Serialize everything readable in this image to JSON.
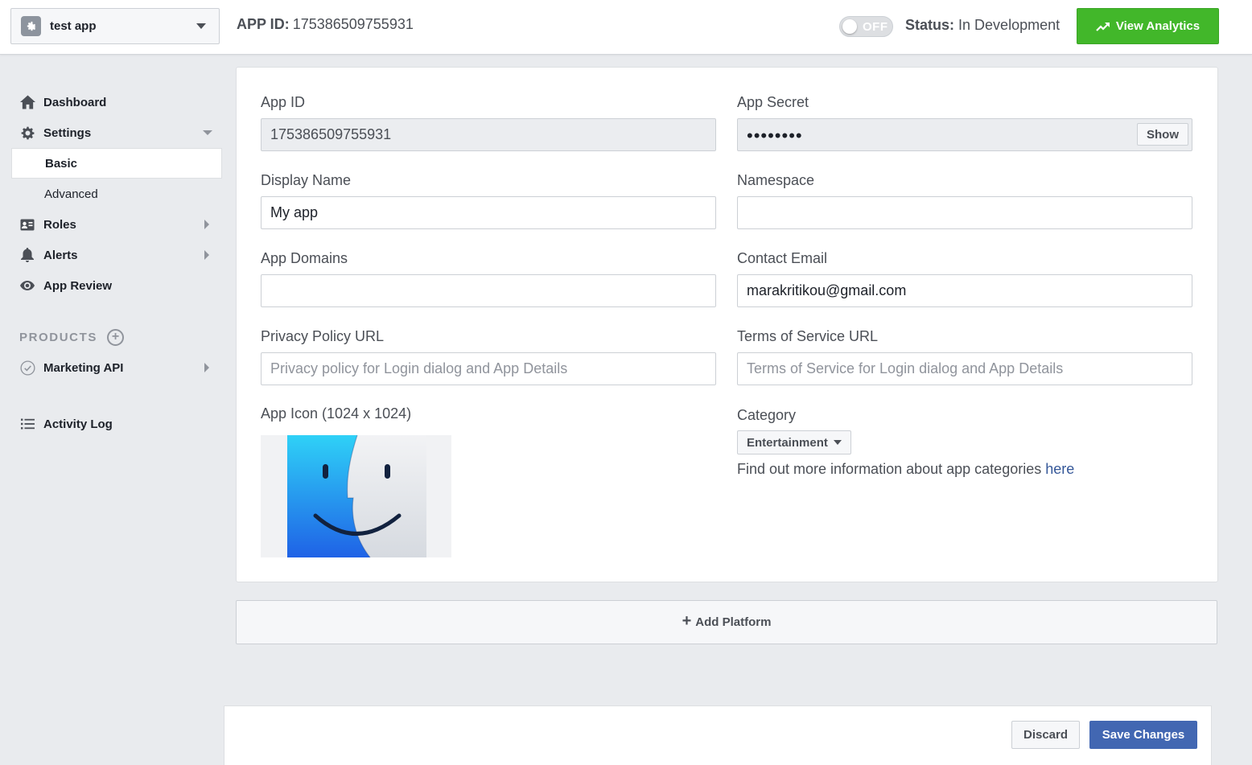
{
  "header": {
    "app_name": "test app",
    "app_id_label": "APP ID:",
    "app_id_value": "175386509755931",
    "toggle_text": "OFF",
    "status_label": "Status:",
    "status_value": "In Development",
    "analytics_label": "View Analytics"
  },
  "sidebar": {
    "dashboard": "Dashboard",
    "settings": "Settings",
    "basic": "Basic",
    "advanced": "Advanced",
    "roles": "Roles",
    "alerts": "Alerts",
    "app_review": "App Review",
    "products_heading": "PRODUCTS",
    "marketing_api": "Marketing API",
    "activity_log": "Activity Log"
  },
  "form": {
    "app_id": {
      "label": "App ID",
      "value": "175386509755931"
    },
    "app_secret": {
      "label": "App Secret",
      "masked": "••••••••",
      "show_label": "Show"
    },
    "display_name": {
      "label": "Display Name",
      "value": "My app"
    },
    "namespace": {
      "label": "Namespace",
      "value": ""
    },
    "app_domains": {
      "label": "App Domains",
      "value": ""
    },
    "contact_email": {
      "label": "Contact Email",
      "value": "marakritikou@gmail.com"
    },
    "privacy_url": {
      "label": "Privacy Policy URL",
      "placeholder": "Privacy policy for Login dialog and App Details"
    },
    "terms_url": {
      "label": "Terms of Service URL",
      "placeholder": "Terms of Service for Login dialog and App Details"
    },
    "app_icon": {
      "label": "App Icon (1024 x 1024)"
    },
    "category": {
      "label": "Category",
      "selected": "Entertainment",
      "info_text": "Find out more information about app categories",
      "info_link": "here"
    }
  },
  "add_platform_label": "Add Platform",
  "footer": {
    "discard_label": "Discard",
    "save_label": "Save Changes"
  },
  "colors": {
    "accent_blue": "#4267b2",
    "success_green": "#42b72a",
    "link_blue": "#365899",
    "page_background": "#e9ebee"
  }
}
